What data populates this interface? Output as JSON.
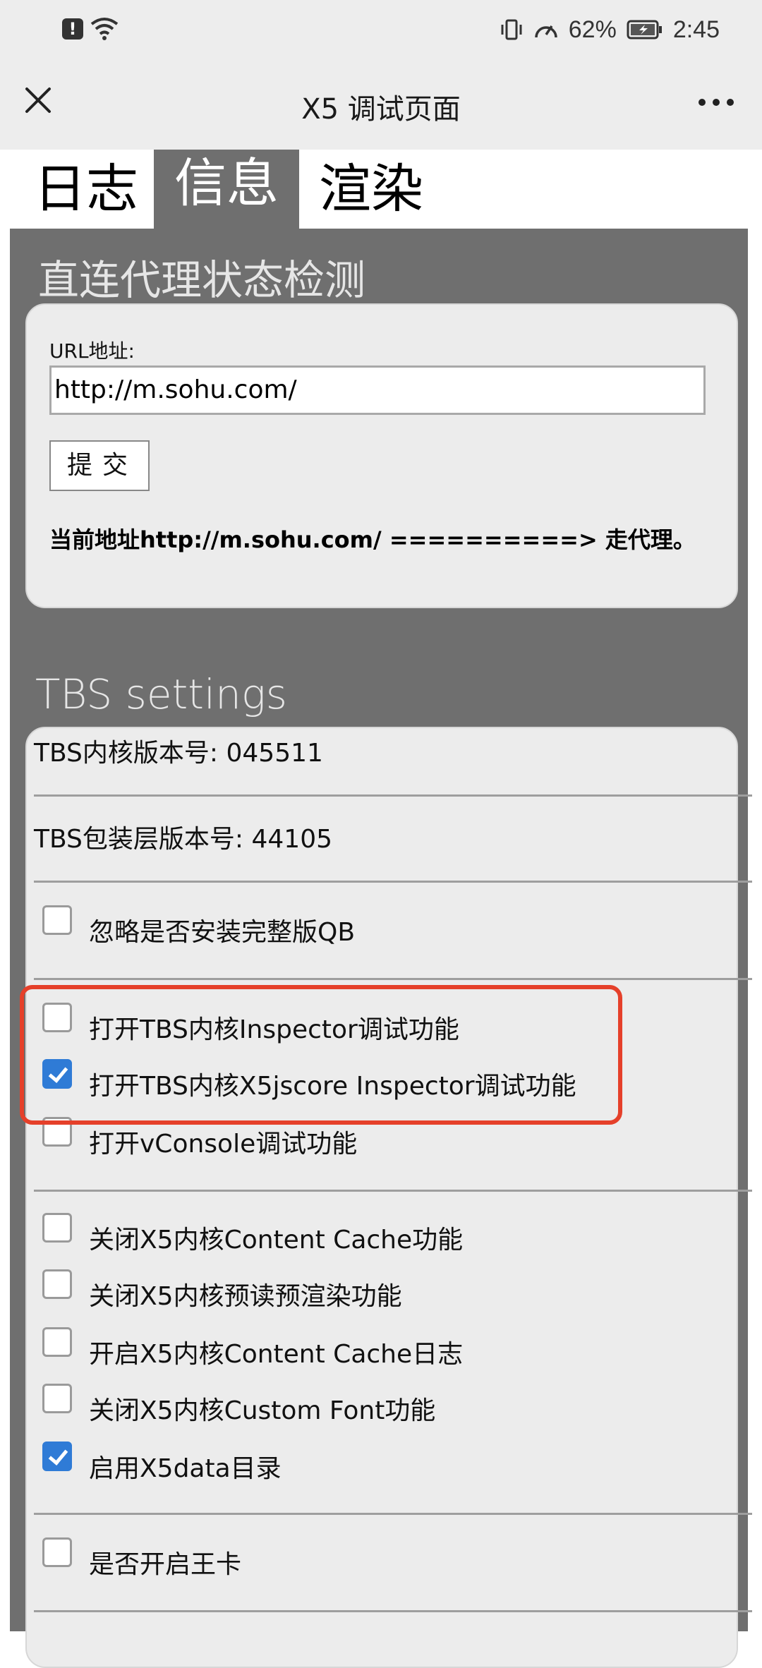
{
  "status_bar": {
    "alert_icon": "alert-icon",
    "wifi_icon": "wifi-icon",
    "vibrate_icon": "vibrate-icon",
    "speed_icon": "speedometer-icon",
    "battery_percent": "62%",
    "battery_icon": "battery-charging-icon",
    "time": "2:45"
  },
  "nav": {
    "close_icon": "close-icon",
    "title": "X5 调试页面",
    "more_icon": "more-dots-icon"
  },
  "tabs": [
    {
      "label": "日志",
      "active": false
    },
    {
      "label": "信息",
      "active": true
    },
    {
      "label": "渲染",
      "active": false
    }
  ],
  "proxy_section": {
    "title": "直连代理状态检测",
    "url_label": "URL地址:",
    "url_value": "http://m.sohu.com/",
    "submit_label": "提交",
    "status_text": "当前地址http://m.sohu.com/ ==========> 走代理。"
  },
  "tbs_section": {
    "title": "TBS settings",
    "kernel_version": "TBS内核版本号: 045511",
    "wrapper_version": "TBS包装层版本号: 44105",
    "options": [
      {
        "label": "忽略是否安装完整版QB",
        "checked": false
      },
      {
        "label": "打开TBS内核Inspector调试功能",
        "checked": false
      },
      {
        "label": "打开TBS内核X5jscore Inspector调试功能",
        "checked": true
      },
      {
        "label": "打开vConsole调试功能",
        "checked": false
      },
      {
        "label": "关闭X5内核Content Cache功能",
        "checked": false
      },
      {
        "label": "关闭X5内核预读预渲染功能",
        "checked": false
      },
      {
        "label": "开启X5内核Content Cache日志",
        "checked": false
      },
      {
        "label": "关闭X5内核Custom Font功能",
        "checked": false
      },
      {
        "label": "启用X5data目录",
        "checked": true
      },
      {
        "label": "是否开启王卡",
        "checked": false
      }
    ]
  },
  "colors": {
    "highlight": "#e5402a",
    "checkbox_checked": "#2f7bd6",
    "panel_bg": "#6f6f6f"
  }
}
